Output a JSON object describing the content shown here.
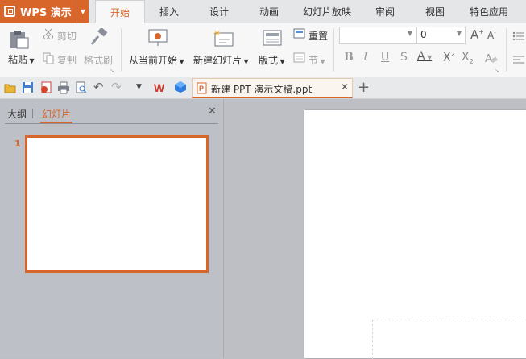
{
  "app": {
    "name": "WPS 演示",
    "accent": "#d8662b"
  },
  "tabs": [
    "开始",
    "插入",
    "设计",
    "动画",
    "幻灯片放映",
    "审阅",
    "视图",
    "特色应用"
  ],
  "active_tab": "开始",
  "ribbon": {
    "paste": "粘贴",
    "cut": "剪切",
    "copy": "复制",
    "format_painter": "格式刷",
    "start_from_current": "从当前开始",
    "new_slide": "新建幻灯片",
    "layout": "版式",
    "reset": "重置",
    "section": "节",
    "font_size": "0"
  },
  "quick_access": {
    "document_tab": "新建 PPT 演示文稿.ppt"
  },
  "panel": {
    "outline_tab": "大纲",
    "slides_tab": "幻灯片",
    "slide_number": "1"
  },
  "icons": [
    "logo-icon",
    "paste-icon",
    "cut-icon",
    "copy-icon",
    "format-painter-icon",
    "slideshow-icon",
    "new-slide-icon",
    "layout-icon",
    "reset-icon",
    "section-icon",
    "grow-font-icon",
    "shrink-font-icon",
    "bold-icon",
    "italic-icon",
    "underline-icon",
    "strikethrough-icon",
    "font-color-icon",
    "superscript-icon",
    "subscript-icon",
    "clear-format-icon",
    "bullets-icon",
    "align-left-icon",
    "open-icon",
    "save-icon",
    "export-pdf-icon",
    "print-icon",
    "print-preview-icon",
    "undo-icon",
    "redo-icon",
    "customize-icon",
    "wps-icon",
    "cloud-icon",
    "ppt-icon",
    "close-icon",
    "new-tab-icon"
  ]
}
